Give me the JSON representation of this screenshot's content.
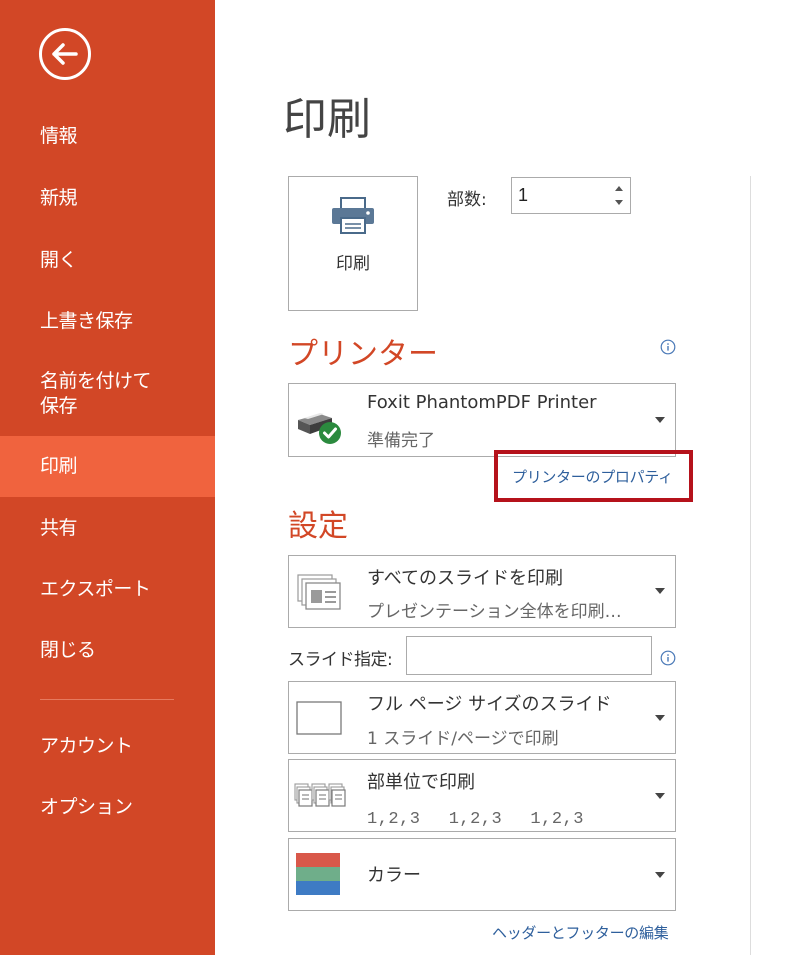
{
  "sidebar": {
    "back_icon": "back-arrow-icon",
    "items": [
      {
        "label": "情報"
      },
      {
        "label": "新規"
      },
      {
        "label": "開く"
      },
      {
        "label": "上書き保存"
      },
      {
        "label": "名前を付けて\n保存"
      },
      {
        "label": "印刷"
      },
      {
        "label": "共有"
      },
      {
        "label": "エクスポート"
      },
      {
        "label": "閉じる"
      },
      {
        "label": "アカウント"
      },
      {
        "label": "オプション"
      }
    ],
    "active_item": "印刷",
    "background": "#d24726",
    "active_background": "#f0633e"
  },
  "main": {
    "title": "印刷",
    "print_button": {
      "label": "印刷",
      "icon": "printer-icon"
    },
    "copies": {
      "label": "部数:",
      "value": "1"
    },
    "printer_section": {
      "heading": "プリンター",
      "printer_name": "Foxit PhantomPDF Printer",
      "printer_status": "準備完了",
      "properties_link": "プリンターのプロパティ"
    },
    "settings_section": {
      "heading": "設定",
      "slides_dropdown": {
        "main": "すべてのスライドを印刷",
        "sub": "プレゼンテーション全体を印刷…"
      },
      "slide_spec_label": "スライド指定:",
      "slide_spec_value": "",
      "layout_dropdown": {
        "main": "フル ページ サイズのスライド",
        "sub": "1 スライド/ページで印刷"
      },
      "collate_dropdown": {
        "main": "部単位で印刷",
        "sub": "1,2,3　 1,2,3　 1,2,3"
      },
      "color_dropdown": {
        "main": "カラー"
      },
      "header_footer_link": "ヘッダーとフッターの編集"
    },
    "accent_color": "#d24726",
    "highlight_color": "#b5121b",
    "link_color": "#2e5f9c"
  }
}
